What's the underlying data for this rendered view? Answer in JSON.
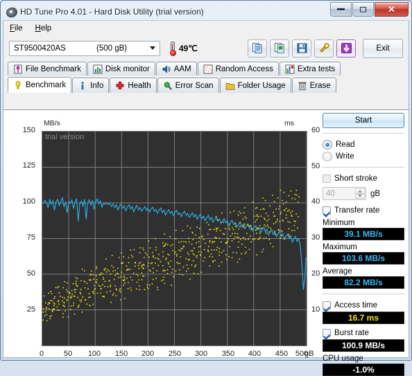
{
  "window": {
    "title": "HD Tune Pro 4.01 - Hard Disk Utility (trial version)",
    "icon": "hard-disk-icon",
    "minimize": "–",
    "maximize": "□",
    "close": "✕"
  },
  "menu": {
    "items": [
      {
        "label": "File",
        "accel": "F"
      },
      {
        "label": "Help",
        "accel": "H"
      }
    ]
  },
  "toolbar": {
    "drive": {
      "name": "ST9500420AS",
      "capacity": "(500 gB)"
    },
    "temperature": "49℃",
    "buttons": [
      {
        "icon": "copy-text-icon"
      },
      {
        "icon": "copy-image-icon"
      },
      {
        "icon": "save-icon"
      },
      {
        "icon": "settings-icon"
      },
      {
        "icon": "download-icon"
      }
    ],
    "exit_label": "Exit"
  },
  "tabs": {
    "row1": [
      {
        "label": "File Benchmark",
        "icon": "file-benchmark-icon",
        "active": false
      },
      {
        "label": "Disk monitor",
        "icon": "disk-monitor-icon",
        "active": false
      },
      {
        "label": "AAM",
        "icon": "aam-speaker-icon",
        "active": false
      },
      {
        "label": "Random Access",
        "icon": "random-access-icon",
        "active": false
      },
      {
        "label": "Extra tests",
        "icon": "extra-tests-icon",
        "active": false
      }
    ],
    "row2": [
      {
        "label": "Benchmark",
        "icon": "benchmark-bulb-icon",
        "active": true
      },
      {
        "label": "Info",
        "icon": "info-icon",
        "active": false
      },
      {
        "label": "Health",
        "icon": "health-cross-icon",
        "active": false
      },
      {
        "label": "Error Scan",
        "icon": "error-scan-magnifier-icon",
        "active": false
      },
      {
        "label": "Folder Usage",
        "icon": "folder-usage-icon",
        "active": false
      },
      {
        "label": "Erase",
        "icon": "erase-trash-icon",
        "active": false
      }
    ]
  },
  "panel": {
    "start_label": "Start",
    "mode": {
      "read_label": "Read",
      "write_label": "Write",
      "selected": "Read"
    },
    "short_stroke": {
      "label": "Short stroke",
      "checked": false,
      "value": "40",
      "unit": "gB"
    },
    "transfer_rate": {
      "label": "Transfer rate",
      "checked": true
    },
    "minimum": {
      "label": "Minimum",
      "value": "39.1 MB/s"
    },
    "maximum": {
      "label": "Maximum",
      "value": "103.6 MB/s"
    },
    "average": {
      "label": "Average",
      "value": "82.2 MB/s"
    },
    "access_time": {
      "label": "Access time",
      "checked": true,
      "value": "16.7 ms"
    },
    "burst_rate": {
      "label": "Burst rate",
      "checked": true,
      "value": "100.9 MB/s"
    },
    "cpu_usage": {
      "label": "CPU usage",
      "value": "-1.0%"
    }
  },
  "colors": {
    "transfer_line": "#29ABE2",
    "access_points": "#F2E515",
    "plot_bg": "#303030",
    "grid": "#8c8c8c"
  },
  "chart_data": {
    "type": "line",
    "title": "",
    "watermark": "trial version",
    "xlabel": "gB",
    "ylabel": "MB/s",
    "y2label": "ms",
    "xlim": [
      0,
      500
    ],
    "ylim": [
      0,
      150
    ],
    "y2lim": [
      0,
      60
    ],
    "xticks": [
      0,
      50,
      100,
      150,
      200,
      250,
      300,
      350,
      400,
      450,
      500
    ],
    "yticks": [
      25,
      50,
      75,
      100,
      125,
      150
    ],
    "y2ticks": [
      10,
      20,
      30,
      40,
      50,
      60
    ],
    "grid": true,
    "series": [
      {
        "name": "Transfer rate",
        "axis": "left",
        "unit": "MB/s",
        "type": "line",
        "color": "#29ABE2",
        "x": [
          2,
          5,
          8,
          11,
          14,
          17,
          20,
          23,
          26,
          29,
          32,
          35,
          38,
          41,
          44,
          47,
          50,
          53,
          56,
          59,
          62,
          65,
          68,
          71,
          74,
          77,
          80,
          83,
          86,
          89,
          92,
          95,
          98,
          101,
          104,
          107,
          110,
          113,
          116,
          119,
          122,
          125,
          128,
          131,
          134,
          137,
          140,
          143,
          146,
          149,
          152,
          155,
          158,
          161,
          164,
          167,
          170,
          173,
          176,
          179,
          182,
          185,
          188,
          191,
          194,
          197,
          200,
          203,
          206,
          209,
          212,
          215,
          218,
          221,
          224,
          227,
          230,
          233,
          236,
          239,
          242,
          245,
          248,
          251,
          254,
          257,
          260,
          263,
          266,
          269,
          272,
          275,
          278,
          281,
          284,
          287,
          290,
          293,
          296,
          299,
          302,
          305,
          308,
          311,
          314,
          317,
          320,
          323,
          326,
          329,
          332,
          335,
          338,
          341,
          344,
          347,
          350,
          353,
          356,
          359,
          362,
          365,
          368,
          371,
          374,
          377,
          380,
          383,
          386,
          389,
          392,
          395,
          398,
          401,
          404,
          407,
          410,
          413,
          416,
          419,
          422,
          425,
          428,
          431,
          434,
          437,
          440,
          443,
          446,
          449,
          452,
          455,
          458,
          461,
          464,
          467,
          470,
          473,
          476,
          479,
          482,
          485,
          488,
          491,
          494,
          497,
          499
        ],
        "y": [
          99.5,
          101.8,
          100.2,
          96.5,
          102.3,
          99.0,
          101.5,
          94.8,
          100.8,
          102.5,
          98.2,
          101.0,
          103.6,
          97.5,
          100.4,
          93.0,
          101.2,
          99.8,
          102.0,
          96.0,
          100.5,
          103.0,
          87.0,
          99.5,
          101.3,
          97.8,
          102.6,
          88.5,
          100.0,
          102.2,
          98.5,
          101.8,
          95.5,
          100.7,
          102.9,
          99.2,
          101.4,
          97.0,
          100.1,
          99.0,
          100.3,
          98.8,
          99.6,
          97.5,
          99.2,
          96.8,
          98.5,
          95.0,
          97.8,
          99.1,
          96.2,
          98.0,
          94.5,
          97.2,
          98.6,
          95.8,
          97.5,
          93.8,
          96.5,
          98.2,
          95.0,
          96.8,
          94.2,
          96.0,
          97.4,
          94.8,
          96.2,
          93.5,
          95.8,
          97.0,
          94.0,
          95.5,
          92.8,
          94.8,
          96.4,
          93.2,
          95.0,
          91.5,
          93.8,
          95.2,
          92.5,
          94.0,
          91.0,
          93.5,
          94.8,
          91.8,
          93.0,
          90.5,
          92.8,
          94.2,
          91.2,
          92.5,
          89.8,
          91.5,
          93.0,
          90.2,
          91.8,
          88.5,
          90.5,
          92.0,
          89.0,
          90.8,
          87.5,
          89.5,
          91.2,
          88.2,
          89.8,
          86.5,
          88.5,
          90.0,
          87.0,
          88.8,
          85.5,
          87.2,
          89.0,
          86.0,
          87.5,
          84.2,
          86.0,
          87.8,
          84.8,
          86.2,
          83.0,
          84.8,
          86.5,
          83.5,
          85.0,
          81.8,
          83.5,
          85.2,
          82.2,
          84.0,
          80.5,
          82.5,
          84.0,
          81.0,
          82.8,
          79.2,
          81.0,
          83.0,
          79.8,
          81.5,
          77.5,
          79.8,
          81.2,
          78.0,
          80.0,
          76.2,
          78.5,
          80.0,
          76.8,
          78.2,
          74.5,
          76.5,
          78.0,
          75.0,
          76.8,
          72.5,
          74.8,
          76.5,
          73.0,
          75.0,
          70.0,
          58.0,
          39.1,
          48.5,
          62.0
        ]
      },
      {
        "name": "Access time",
        "axis": "right",
        "unit": "ms",
        "type": "scatter",
        "color": "#F2E515",
        "x": [
          3,
          6,
          9,
          12,
          15,
          18,
          21,
          24,
          27,
          30,
          33,
          36,
          39,
          42,
          45,
          48,
          51,
          54,
          57,
          60,
          63,
          66,
          69,
          72,
          75,
          78,
          81,
          84,
          87,
          90,
          93,
          96,
          99,
          102,
          105,
          108,
          111,
          114,
          117,
          120,
          123,
          126,
          129,
          132,
          135,
          138,
          141,
          144,
          147,
          150,
          153,
          156,
          159,
          162,
          165,
          168,
          171,
          174,
          177,
          180,
          183,
          186,
          189,
          192,
          195,
          198,
          201,
          204,
          207,
          210,
          213,
          216,
          219,
          222,
          225,
          228,
          231,
          234,
          237,
          240,
          243,
          246,
          249,
          252,
          255,
          258,
          261,
          264,
          267,
          270,
          273,
          276,
          279,
          282,
          285,
          288,
          291,
          294,
          297,
          300,
          303,
          306,
          309,
          312,
          315,
          318,
          321,
          324,
          327,
          330,
          333,
          336,
          339,
          342,
          345,
          348,
          351,
          354,
          357,
          360,
          363,
          366,
          369,
          372,
          375,
          378,
          381,
          384,
          387,
          390,
          393,
          396,
          399,
          402,
          405,
          408,
          411,
          414,
          417,
          420,
          423,
          426,
          429,
          432,
          435,
          438,
          441,
          444,
          447,
          450,
          453,
          456,
          459,
          462,
          465,
          468,
          471,
          474,
          477,
          480,
          483,
          486,
          489,
          492,
          495,
          498
        ],
        "y": [
          8.2,
          9.5,
          7.8,
          11.2,
          8.8,
          10.5,
          9.2,
          12.8,
          8.5,
          11.5,
          13.2,
          9.8,
          10.2,
          14.5,
          8.0,
          12.0,
          15.2,
          10.8,
          13.5,
          9.5,
          16.0,
          11.8,
          14.2,
          12.5,
          17.5,
          10.5,
          15.8,
          13.0,
          18.2,
          11.2,
          16.5,
          14.8,
          12.2,
          19.0,
          15.0,
          17.2,
          13.8,
          20.5,
          16.2,
          14.5,
          18.8,
          12.8,
          21.0,
          17.8,
          15.5,
          19.5,
          13.5,
          22.2,
          18.0,
          16.8,
          20.2,
          14.2,
          23.0,
          19.2,
          17.0,
          21.5,
          15.8,
          24.2,
          18.5,
          22.0,
          16.5,
          20.8,
          25.0,
          19.8,
          17.5,
          23.5,
          21.2,
          15.0,
          26.0,
          20.0,
          24.0,
          18.2,
          22.8,
          16.2,
          27.2,
          21.8,
          25.2,
          19.5,
          23.2,
          17.8,
          28.0,
          22.5,
          26.2,
          20.5,
          24.5,
          18.8,
          29.2,
          23.8,
          27.0,
          21.0,
          25.5,
          19.2,
          30.0,
          24.8,
          22.2,
          28.2,
          26.0,
          20.2,
          31.0,
          25.0,
          23.0,
          29.0,
          27.2,
          21.5,
          32.2,
          26.5,
          24.2,
          30.2,
          28.0,
          22.8,
          33.0,
          27.5,
          25.2,
          31.2,
          29.2,
          23.5,
          34.0,
          28.5,
          26.2,
          32.0,
          30.0,
          24.5,
          35.2,
          29.5,
          27.0,
          33.2,
          31.0,
          25.5,
          36.0,
          30.5,
          28.2,
          34.0,
          32.2,
          26.5,
          37.2,
          31.5,
          29.0,
          35.2,
          33.0,
          27.5,
          38.0,
          32.5,
          30.2,
          36.0,
          34.2,
          28.5,
          39.0,
          33.5,
          31.0,
          37.2,
          35.0,
          29.5,
          40.2,
          34.5,
          32.2,
          38.0,
          36.2,
          30.5,
          41.0,
          35.5,
          33.0,
          39.2
        ]
      }
    ]
  }
}
